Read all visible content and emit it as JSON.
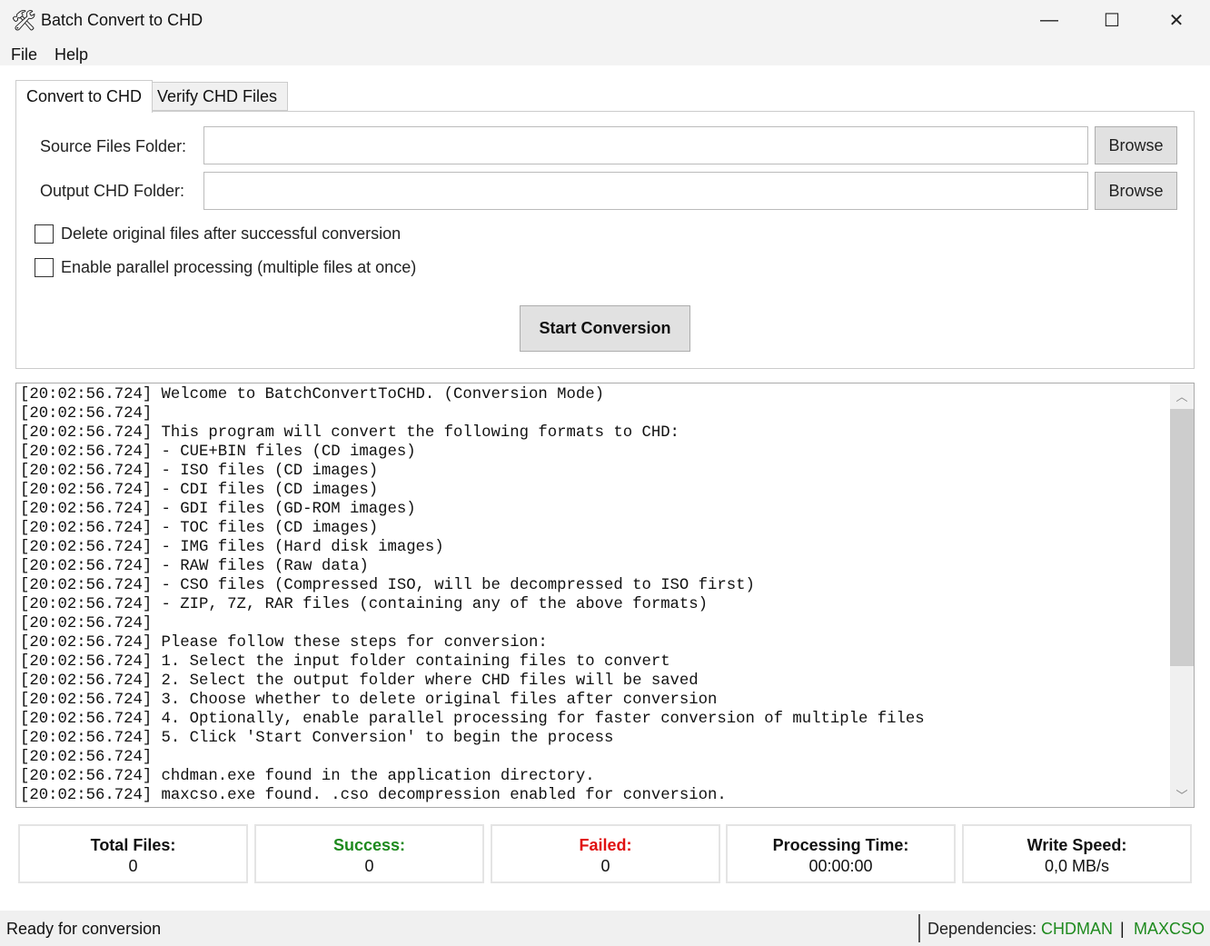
{
  "window": {
    "title": "Batch Convert to CHD",
    "minimize": "—",
    "maximize": "☐",
    "close": "✕",
    "icon": "tools-icon"
  },
  "menu": [
    "File",
    "Help"
  ],
  "tabs": [
    "Convert to CHD",
    "Verify CHD Files"
  ],
  "form": {
    "source_label": "Source Files Folder:",
    "source_value": "",
    "output_label": "Output CHD Folder:",
    "output_value": "",
    "browse": "Browse",
    "delete_label": "Delete original files after successful conversion",
    "parallel_label": "Enable parallel processing (multiple files at once)",
    "start": "Start Conversion"
  },
  "log": [
    "[20:02:56.724] Welcome to BatchConvertToCHD. (Conversion Mode)",
    "[20:02:56.724]",
    "[20:02:56.724] This program will convert the following formats to CHD:",
    "[20:02:56.724] - CUE+BIN files (CD images)",
    "[20:02:56.724] - ISO files (CD images)",
    "[20:02:56.724] - CDI files (CD images)",
    "[20:02:56.724] - GDI files (GD-ROM images)",
    "[20:02:56.724] - TOC files (CD images)",
    "[20:02:56.724] - IMG files (Hard disk images)",
    "[20:02:56.724] - RAW files (Raw data)",
    "[20:02:56.724] - CSO files (Compressed ISO, will be decompressed to ISO first)",
    "[20:02:56.724] - ZIP, 7Z, RAR files (containing any of the above formats)",
    "[20:02:56.724]",
    "[20:02:56.724] Please follow these steps for conversion:",
    "[20:02:56.724] 1. Select the input folder containing files to convert",
    "[20:02:56.724] 2. Select the output folder where CHD files will be saved",
    "[20:02:56.724] 3. Choose whether to delete original files after conversion",
    "[20:02:56.724] 4. Optionally, enable parallel processing for faster conversion of multiple files",
    "[20:02:56.724] 5. Click 'Start Conversion' to begin the process",
    "[20:02:56.724]",
    "[20:02:56.724] chdman.exe found in the application directory.",
    "[20:02:56.724] maxcso.exe found. .cso decompression enabled for conversion."
  ],
  "stats": [
    {
      "label": "Total Files:",
      "value": "0",
      "color": "#111111"
    },
    {
      "label": "Success:",
      "value": "0",
      "color": "#1e8a1e"
    },
    {
      "label": "Failed:",
      "value": "0",
      "color": "#e01010"
    },
    {
      "label": "Processing Time:",
      "value": "00:00:00",
      "color": "#111111"
    },
    {
      "label": "Write Speed:",
      "value": "0,0 MB/s",
      "color": "#111111"
    }
  ],
  "status": {
    "text": "Ready for conversion",
    "deps_label": "Dependencies:",
    "dep1": "CHDMAN",
    "sep": "|",
    "dep2": "MAXCSO"
  }
}
